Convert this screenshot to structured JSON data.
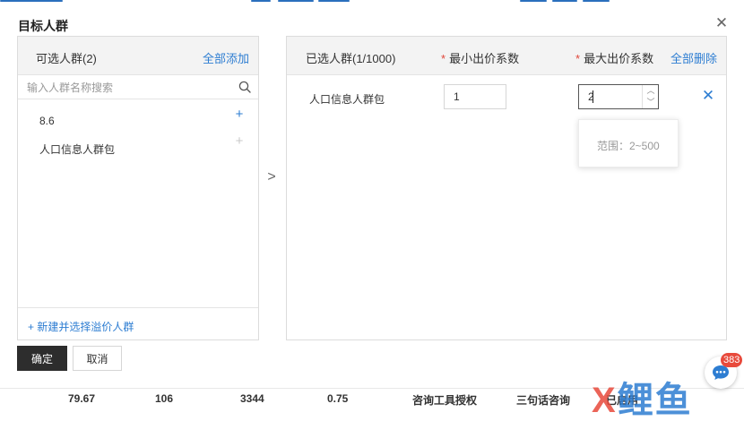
{
  "dialog": {
    "title": "目标人群"
  },
  "left_panel": {
    "title": "可选人群(2)",
    "add_all_label": "全部添加",
    "search_placeholder": "输入人群名称搜索",
    "items": [
      {
        "label": "8.6",
        "add_enabled": true
      },
      {
        "label": "人口信息人群包",
        "add_enabled": false
      }
    ],
    "new_link": "+ 新建并选择溢价人群"
  },
  "right_panel": {
    "title": "已选人群(1/1000)",
    "min_label": "最小出价系数",
    "max_label": "最大出价系数",
    "delete_all_label": "全部删除",
    "rows": [
      {
        "name": "人口信息人群包",
        "min_value": "1",
        "max_value": "2"
      }
    ],
    "tooltip": "范围：2~500"
  },
  "footer": {
    "ok_label": "确定",
    "cancel_label": "取消"
  },
  "chat": {
    "badge": "383"
  },
  "bottom_row": {
    "cells": [
      "79.67",
      "106",
      "3344",
      "0.75",
      "咨询工具授权",
      "三句话咨询",
      "已启用"
    ]
  },
  "watermark": {
    "part1": "X",
    "part2": "鲤鱼"
  },
  "colors": {
    "link": "#2d7dd2",
    "required": "#e0463a",
    "primary_button": "#2d2d2d",
    "badge": "#e84a3c"
  }
}
